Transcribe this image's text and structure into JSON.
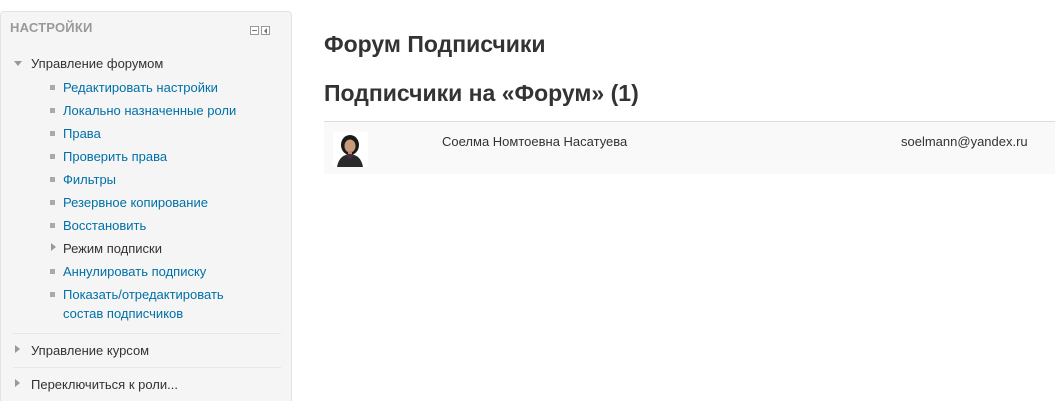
{
  "settings_block": {
    "title": "НАСТРОЙКИ",
    "forum_admin": {
      "label": "Управление форумом",
      "items": [
        {
          "label": "Редактировать настройки"
        },
        {
          "label": "Локально назначенные роли"
        },
        {
          "label": "Права"
        },
        {
          "label": "Проверить права"
        },
        {
          "label": "Фильтры"
        },
        {
          "label": "Резервное копирование"
        },
        {
          "label": "Восстановить"
        },
        {
          "label": "Режим подписки"
        },
        {
          "label": "Аннулировать подписку"
        },
        {
          "label_line1": "Показать/отредактировать",
          "label_line2": "состав подписчиков"
        }
      ]
    },
    "course_admin": {
      "label": "Управление курсом"
    },
    "switch_role": {
      "label": "Переключиться к роли..."
    }
  },
  "main": {
    "page_title": "Форум Подписчики",
    "section_title": "Подписчики на «Форум» (1)",
    "subscribers": [
      {
        "name": "Соелма Номтоевна Насатуева",
        "email": "soelmann@yandex.ru"
      }
    ]
  },
  "colors": {
    "link": "#0070a8",
    "block_bg": "#f5f5f5",
    "row_bg": "#f9f9f9"
  }
}
